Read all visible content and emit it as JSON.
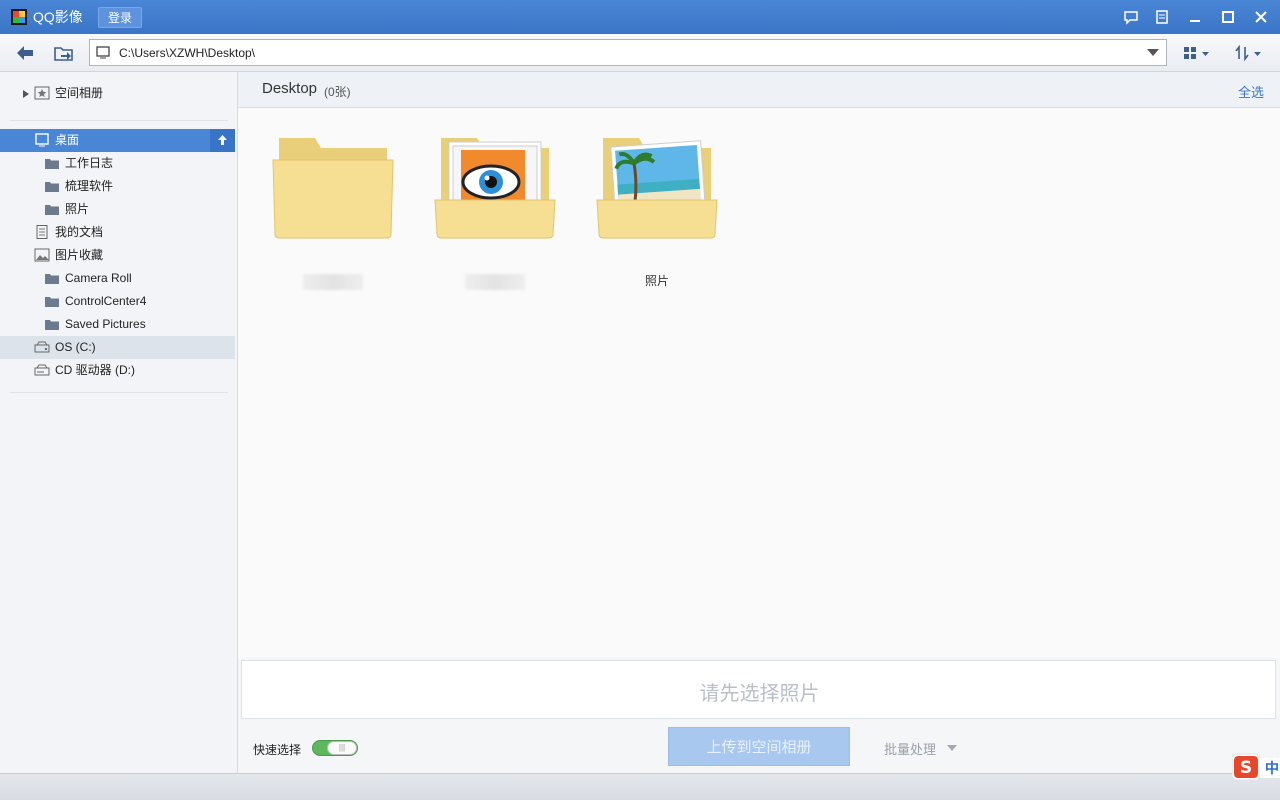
{
  "app": {
    "title": "QQ影像",
    "login_label": "登录"
  },
  "toolbar": {
    "path": "C:\\Users\\XZWH\\Desktop\\"
  },
  "sidebar": {
    "items": [
      {
        "label": "空间相册",
        "icon": "star-album-icon"
      },
      {
        "label": "桌面",
        "icon": "desktop-icon",
        "selected": true
      },
      {
        "label": "工作日志",
        "icon": "folder-icon"
      },
      {
        "label": "梳理软件",
        "icon": "folder-icon"
      },
      {
        "label": "照片",
        "icon": "folder-icon"
      },
      {
        "label": "我的文档",
        "icon": "document-icon"
      },
      {
        "label": "图片收藏",
        "icon": "picture-icon"
      },
      {
        "label": "Camera Roll",
        "icon": "folder-icon"
      },
      {
        "label": "ControlCenter4",
        "icon": "folder-icon"
      },
      {
        "label": "Saved Pictures",
        "icon": "folder-icon"
      },
      {
        "label": "OS (C:)",
        "icon": "drive-icon"
      },
      {
        "label": "CD 驱动器 (D:)",
        "icon": "cd-drive-icon"
      }
    ]
  },
  "main": {
    "folder_title": "Desktop",
    "folder_count": "(0张)",
    "select_all": "全选",
    "folders": [
      {
        "label": "",
        "thumb": "plain-folder"
      },
      {
        "label": "",
        "thumb": "eye-image-folder"
      },
      {
        "label": "照片",
        "thumb": "beach-photo-folder"
      }
    ]
  },
  "bottom": {
    "drop_text": "请先选择照片",
    "quick_select_label": "快速选择",
    "upload_label": "上传到空间相册",
    "batch_label": "批量处理"
  },
  "ime": {
    "label": "中"
  },
  "colors": {
    "titlebar": "#3a74c6",
    "accent": "#3b78c3",
    "selected": "#4a86d6"
  }
}
